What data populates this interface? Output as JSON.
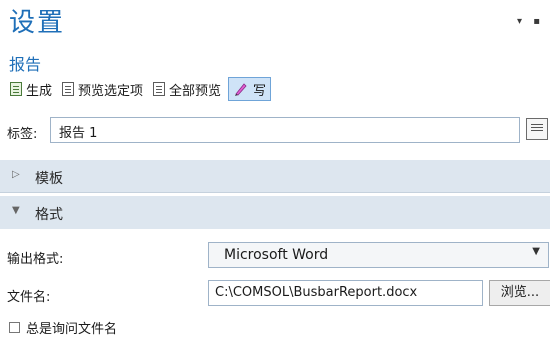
{
  "header": {
    "title": "设置",
    "subtitle": "报告",
    "window_controls": "▾ ▪"
  },
  "toolbar": {
    "generate_label": "生成",
    "preview_selected_label": "预览选定项",
    "preview_all_label": "全部预览",
    "write_label": "写"
  },
  "label_field": {
    "label": "标签:",
    "value": "报告 1"
  },
  "sections": {
    "template": {
      "arrow": "▷",
      "title": "模板"
    },
    "format": {
      "arrow": "▼",
      "title": "格式"
    }
  },
  "format": {
    "output_label": "输出格式:",
    "output_value": "Microsoft Word",
    "caret": "▼",
    "filename_label": "文件名:",
    "filename_value": "C:\\COMSOL\\BusbarReport.docx",
    "browse_label": "浏览...",
    "always_ask_label": "总是询问文件名",
    "always_ask_checked": false
  }
}
